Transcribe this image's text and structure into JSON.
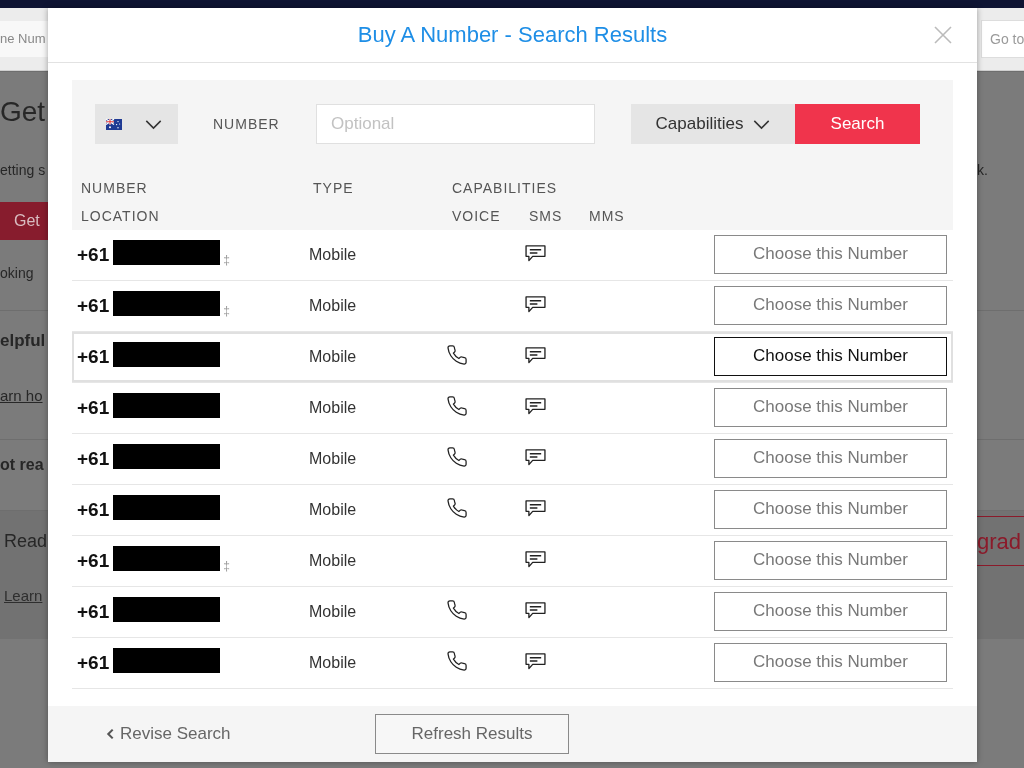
{
  "background": {
    "sections": [
      {
        "kind": "band",
        "lines": [
          {
            "left": {
              "kind": "field",
              "text": "ne Num"
            },
            "right": {
              "kind": "field",
              "text": "Go to"
            }
          }
        ]
      },
      {
        "kind": "plain",
        "lines": [
          {
            "left": {
              "kind": "heading",
              "text": "Get"
            }
          },
          {
            "left": {
              "kind": "text",
              "text": "etting s"
            },
            "right": {
              "kind": "text",
              "text": "k."
            }
          },
          {
            "left": {
              "kind": "button",
              "text": "Get"
            }
          },
          {
            "left": {
              "kind": "text",
              "text": "oking"
            }
          }
        ]
      },
      {
        "kind": "plain",
        "lines": [
          {
            "left": {
              "kind": "subheading",
              "text": "elpful"
            }
          },
          {
            "left": {
              "kind": "link",
              "text": "arn ho"
            }
          }
        ]
      },
      {
        "kind": "plain",
        "lines": [
          {
            "left": {
              "kind": "bold",
              "text": "ot rea"
            }
          }
        ]
      },
      {
        "kind": "card",
        "lines": [
          {
            "left": {
              "kind": "title",
              "text": "Read"
            },
            "right": {
              "kind": "outline_button",
              "text": "grad"
            }
          },
          {
            "left": {
              "kind": "link",
              "text": "Learn"
            }
          }
        ]
      }
    ]
  },
  "dialog": {
    "title": "Buy A Number - Search Results",
    "search": {
      "number_label": "NUMBER",
      "number_field": {
        "placeholder": "Optional"
      },
      "capabilities": "Capabilities",
      "button": "Search"
    },
    "columns": [
      {
        "label": "NUMBER",
        "sublabel": "LOCATION"
      },
      {
        "label": "TYPE"
      },
      {
        "label": "CAPABILITIES",
        "sublabels": [
          "VOICE",
          "SMS",
          "MMS"
        ]
      }
    ],
    "rows": [
      {
        "prefix": "+61",
        "mark": "‡",
        "type": "Mobile",
        "voice": false,
        "sms": true,
        "action": "Choose this Number",
        "highlighted": false
      },
      {
        "prefix": "+61",
        "mark": "‡",
        "type": "Mobile",
        "voice": false,
        "sms": true,
        "action": "Choose this Number",
        "highlighted": false
      },
      {
        "prefix": "+61",
        "type": "Mobile",
        "voice": true,
        "sms": true,
        "action": "Choose this Number",
        "highlighted": true
      },
      {
        "prefix": "+61",
        "type": "Mobile",
        "voice": true,
        "sms": true,
        "action": "Choose this Number",
        "highlighted": false
      },
      {
        "prefix": "+61",
        "type": "Mobile",
        "voice": true,
        "sms": true,
        "action": "Choose this Number",
        "highlighted": false
      },
      {
        "prefix": "+61",
        "type": "Mobile",
        "voice": true,
        "sms": true,
        "action": "Choose this Number",
        "highlighted": false
      },
      {
        "prefix": "+61",
        "mark": "‡",
        "type": "Mobile",
        "voice": false,
        "sms": true,
        "action": "Choose this Number",
        "highlighted": false
      },
      {
        "prefix": "+61",
        "type": "Mobile",
        "voice": true,
        "sms": true,
        "action": "Choose this Number",
        "highlighted": false
      },
      {
        "prefix": "+61",
        "type": "Mobile",
        "voice": true,
        "sms": true,
        "action": "Choose this Number",
        "highlighted": false
      }
    ],
    "footer": {
      "revise": "Revise Search",
      "refresh": "Refresh Results"
    }
  }
}
